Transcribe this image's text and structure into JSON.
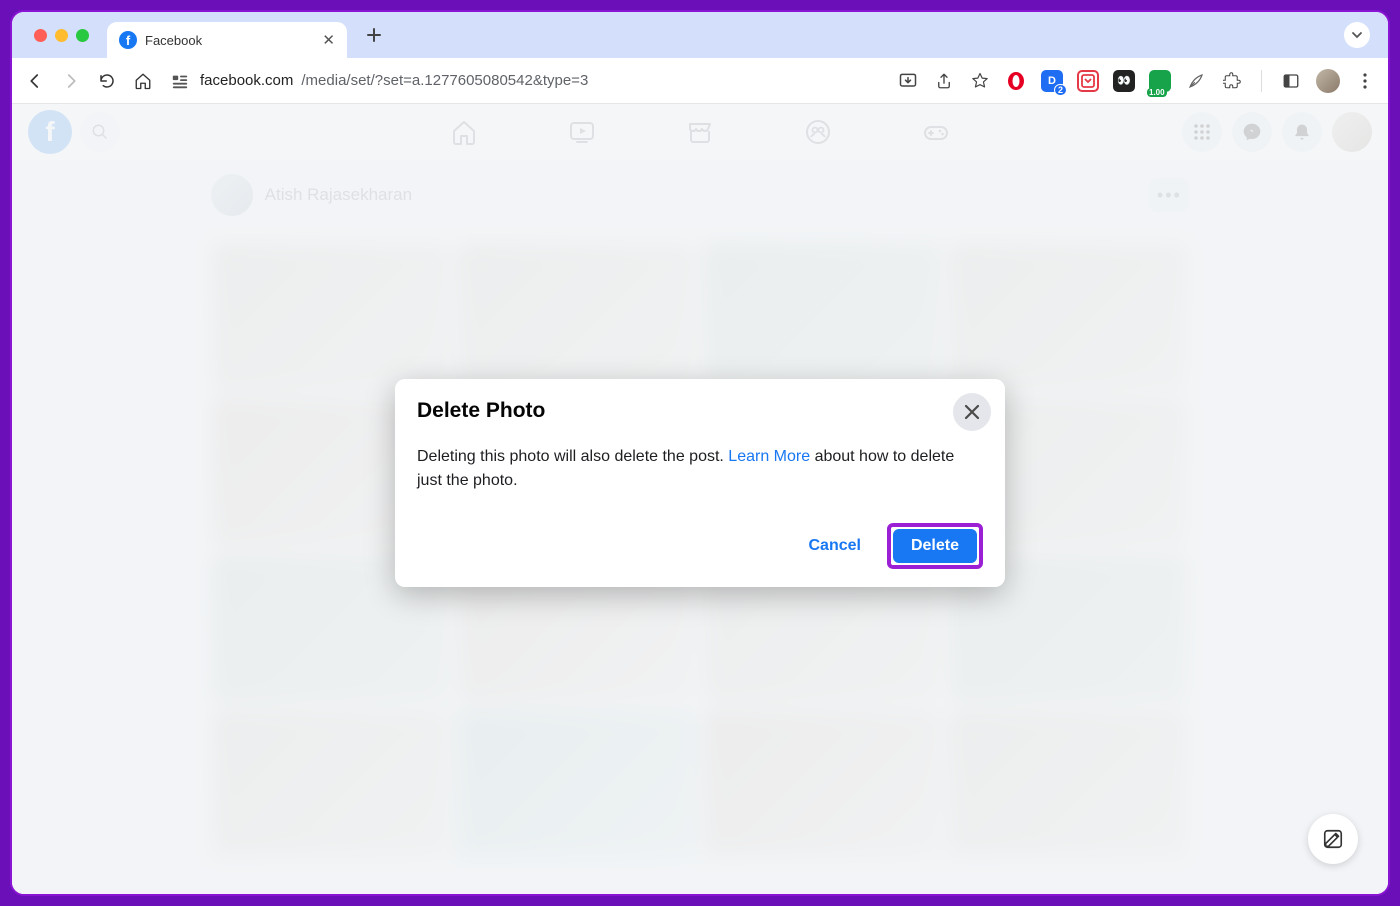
{
  "browser": {
    "tab_title": "Facebook",
    "url_domain": "facebook.com",
    "url_path": "/media/set/?set=a.1277605080542&type=3",
    "extensions_badge_1": "2",
    "extensions_badge_2": "1.00"
  },
  "facebook": {
    "profile_name": "Atish Rajasekharan"
  },
  "modal": {
    "title": "Delete Photo",
    "body_pre": "Deleting this photo will also delete the post. ",
    "learn_more": "Learn More",
    "body_post": " about how to delete just the photo.",
    "cancel": "Cancel",
    "delete": "Delete"
  }
}
